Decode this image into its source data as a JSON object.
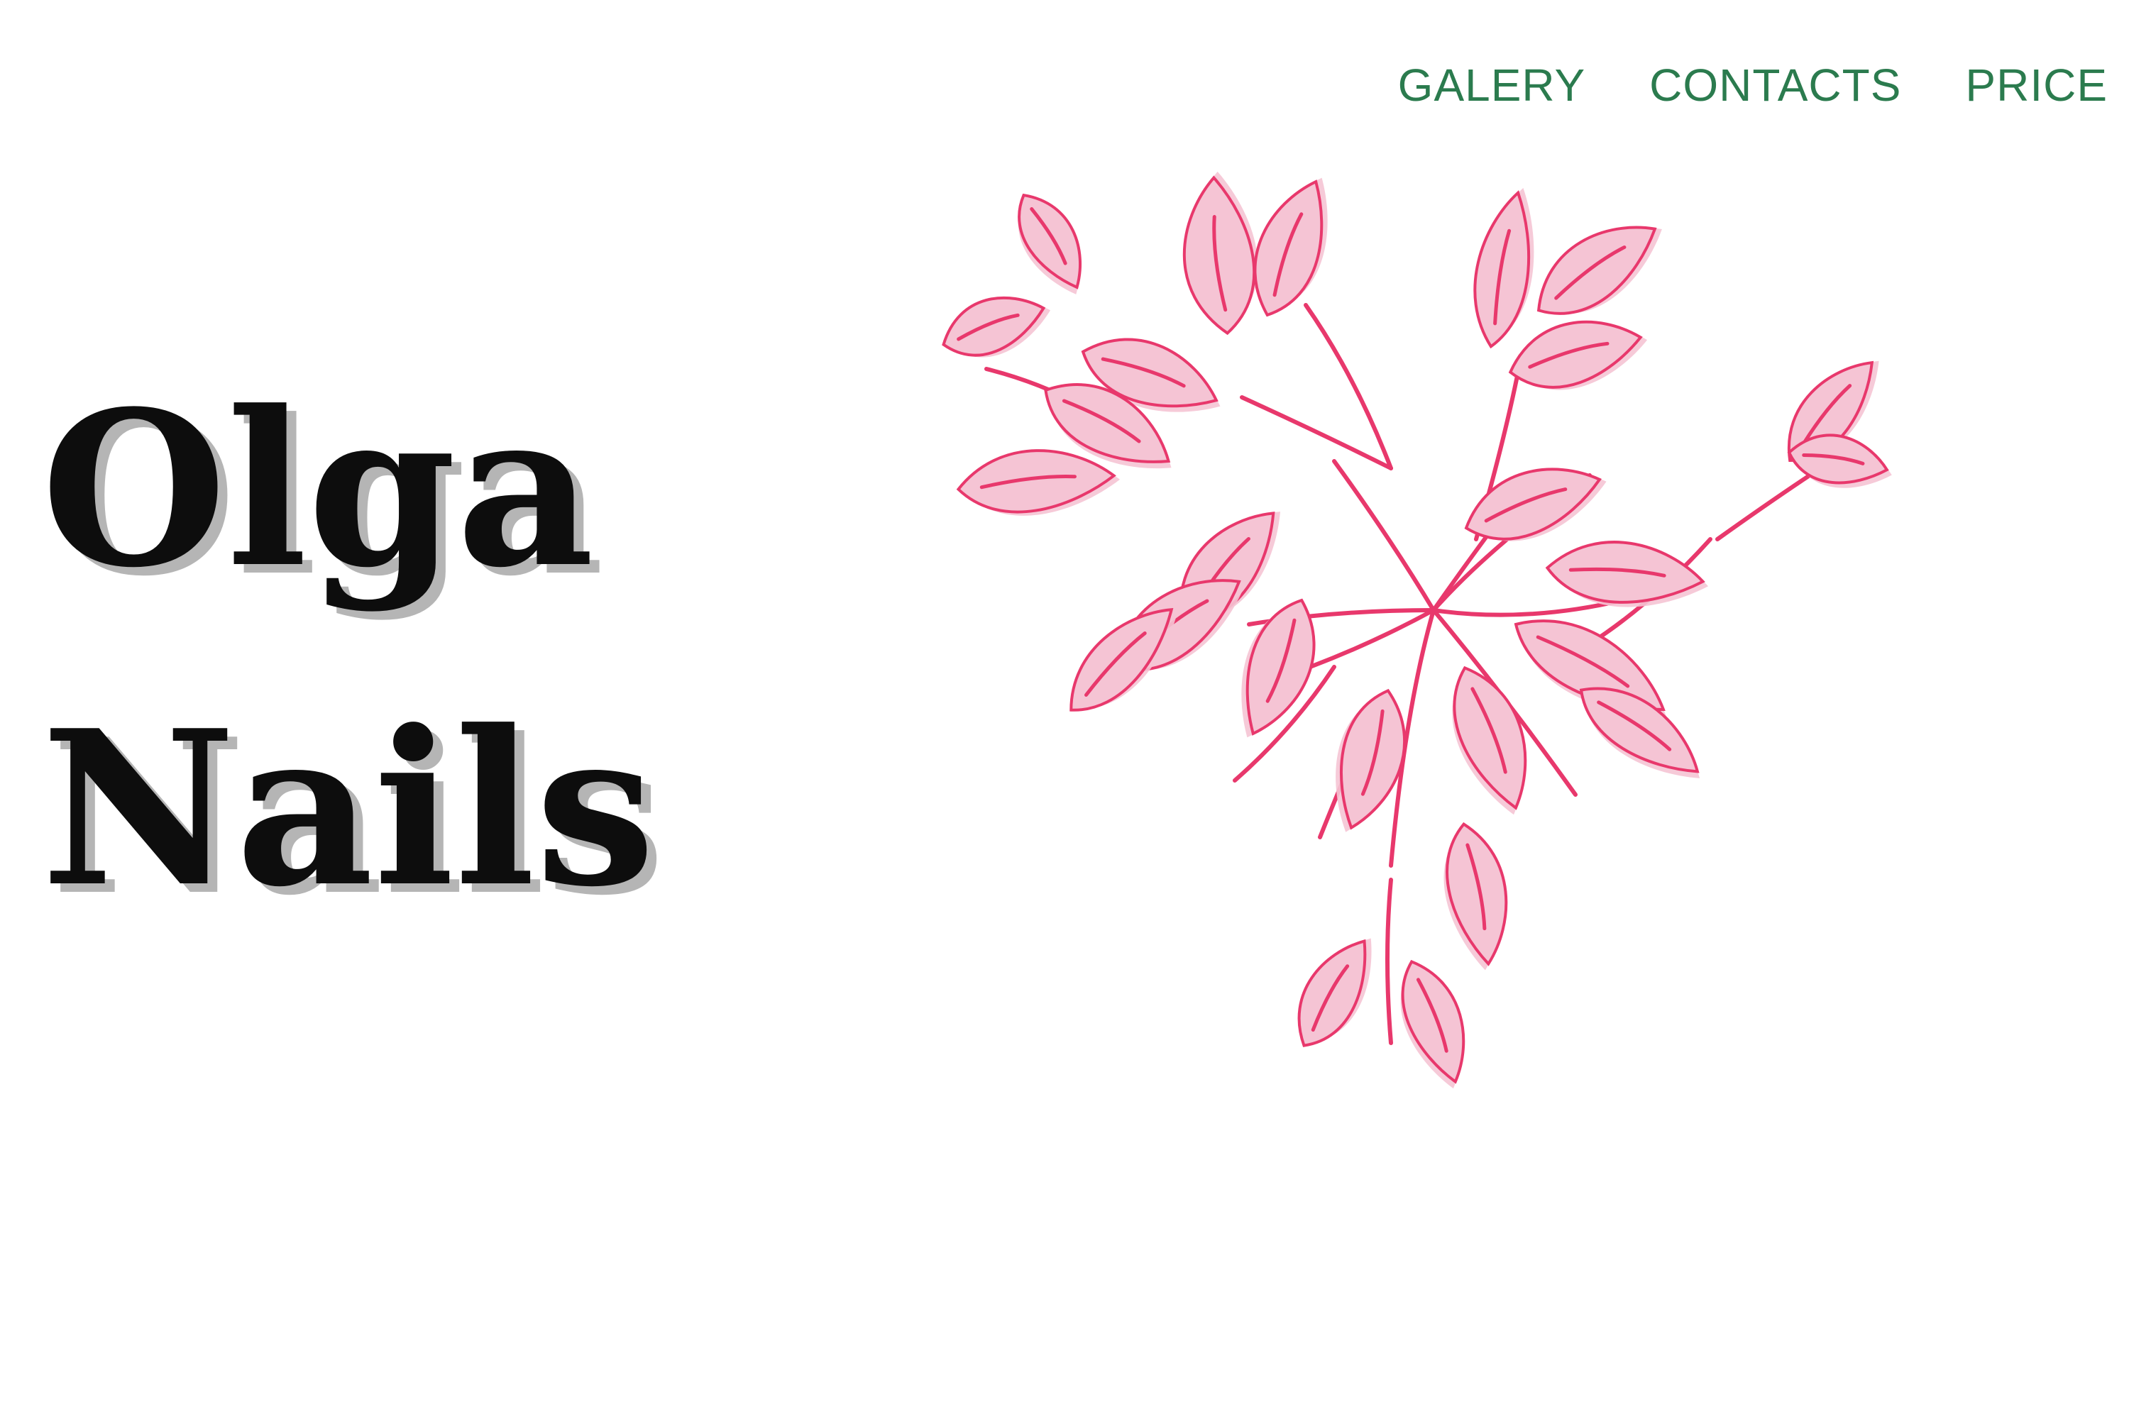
{
  "nav": {
    "links": [
      {
        "label": "GALERY"
      },
      {
        "label": "CONTACTS"
      },
      {
        "label": "PRICE"
      }
    ]
  },
  "hero": {
    "line1": "Olga",
    "line2": "Nails"
  },
  "colors": {
    "nav_text": "#2b7b4e",
    "title_text": "#0d0d0d",
    "title_shadow": "#b5b5b5",
    "leaf_fill": "#f5c4d4",
    "leaf_stroke": "#e8386c",
    "background": "#ffffff"
  },
  "illustration": {
    "icon": "pink-leaves-illustration"
  }
}
